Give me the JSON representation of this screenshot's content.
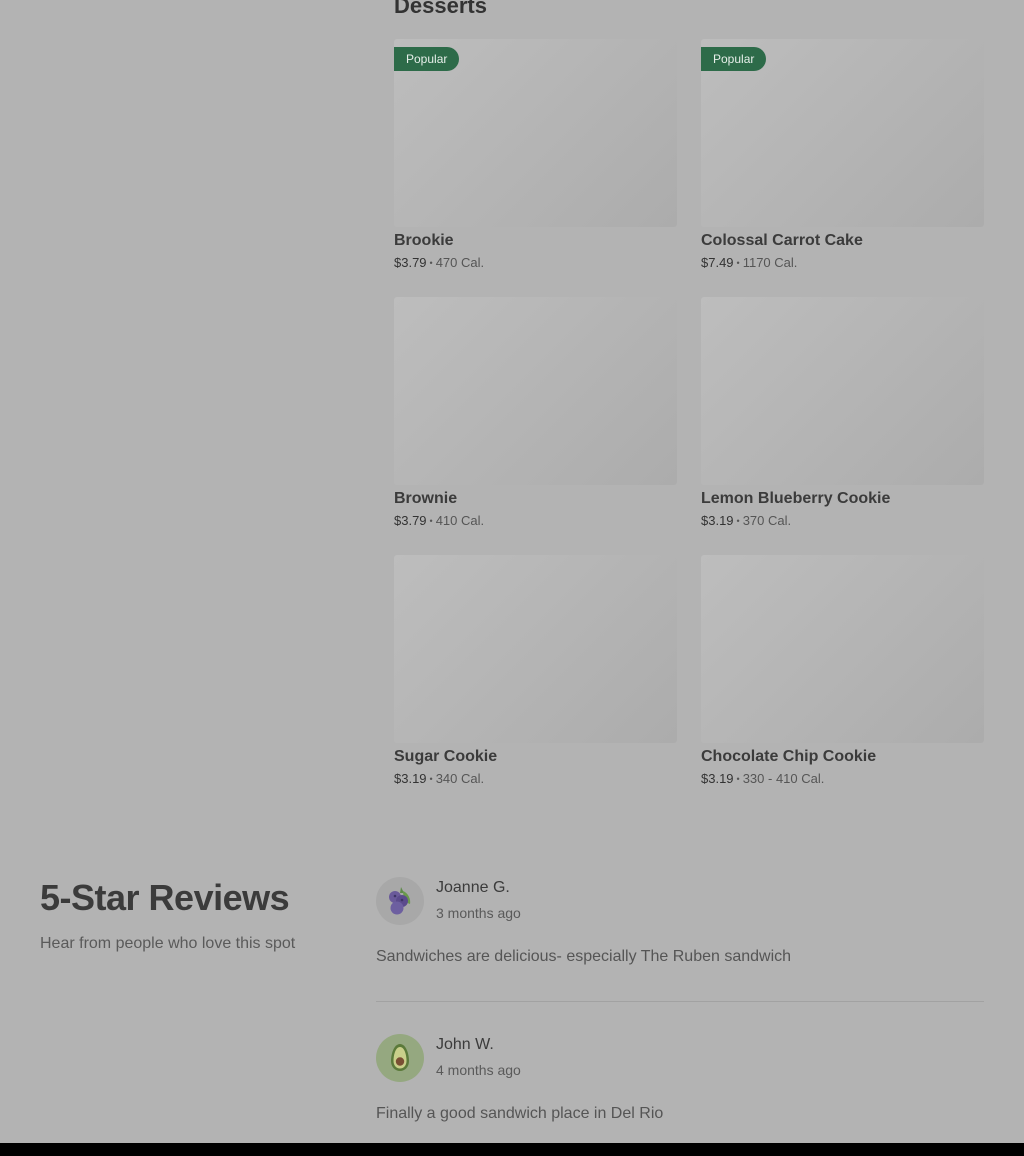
{
  "desserts": {
    "title": "Desserts",
    "items": [
      {
        "name": "Brookie",
        "price": "$3.79",
        "calories": "470 Cal.",
        "badge": "Popular"
      },
      {
        "name": "Colossal Carrot Cake",
        "price": "$7.49",
        "calories": "1170 Cal.",
        "badge": "Popular"
      },
      {
        "name": "Brownie",
        "price": "$3.79",
        "calories": "410 Cal."
      },
      {
        "name": "Lemon Blueberry Cookie",
        "price": "$3.19",
        "calories": "370 Cal."
      },
      {
        "name": "Sugar Cookie",
        "price": "$3.19",
        "calories": "340 Cal."
      },
      {
        "name": "Chocolate Chip Cookie",
        "price": "$3.19",
        "calories": "330 - 410 Cal."
      }
    ],
    "separator": "•"
  },
  "reviews": {
    "title": "5-Star Reviews",
    "subtitle": "Hear from people who love this spot",
    "items": [
      {
        "name": "Joanne G.",
        "time": "3 months ago",
        "text": "Sandwiches are delicious- especially The Ruben sandwich",
        "avatar_icon": "blueberry-icon",
        "avatar_bg": "#a8a8a8"
      },
      {
        "name": "John W.",
        "time": "4 months ago",
        "text": "Finally a good sandwich place in Del Rio",
        "avatar_icon": "avocado-icon",
        "avatar_bg": "#95a880"
      }
    ]
  },
  "colors": {
    "background": "#b3b3b3",
    "badge": "#2d6b49",
    "text": "#333333"
  }
}
